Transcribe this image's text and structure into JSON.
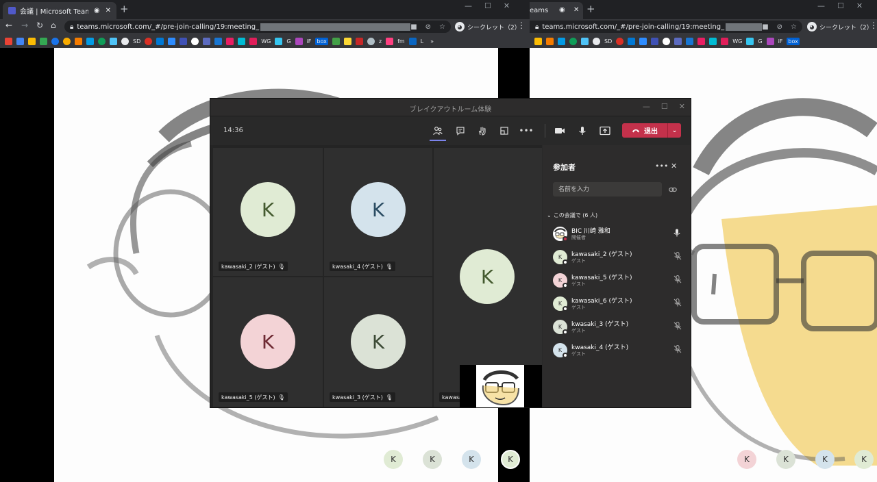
{
  "left_browser": {
    "tab_title": "会議 | Microsoft Teams",
    "url_prefix": "teams.microsoft.com/_#/pre-join-calling/19:meeting_",
    "incognito_label": "シークレット（2）"
  },
  "right_browser": {
    "tab_title": "eams",
    "url_prefix": "teams.microsoft.com/_#/pre-join-calling/19:meeting_",
    "incognito_label": "シークレット（2）"
  },
  "bookmarks": {
    "sd": "SD",
    "wg": "WG",
    "g": "G",
    "if": "iF",
    "box": "box",
    "z": "z",
    "fm": "fm",
    "l": "L",
    "more": "»"
  },
  "teams_window": {
    "title": "ブレイクアウトルーム体験",
    "time": "14:36",
    "leave_label": "退出"
  },
  "tiles": [
    {
      "name": "kawasaki_2 (ゲスト)",
      "initial": "K"
    },
    {
      "name": "kwasaki_4 (ゲスト)",
      "initial": "K"
    },
    {
      "name": "kawasaki_5 (ゲスト)",
      "initial": "K"
    },
    {
      "name": "kwasaki_3 (ゲスト)",
      "initial": "K"
    },
    {
      "name": "kawasak",
      "initial": "K"
    }
  ],
  "participants_panel": {
    "title": "参加者",
    "search_placeholder": "名前を入力",
    "section_label": "この会議で (6 人)",
    "people": [
      {
        "name": "BIC 川崎 雅和",
        "role": "開催者",
        "initial": ""
      },
      {
        "name": "kawasaki_2 (ゲスト)",
        "role": "ゲスト",
        "initial": "K"
      },
      {
        "name": "kawasaki_5 (ゲスト)",
        "role": "ゲスト",
        "initial": "K"
      },
      {
        "name": "kawasaki_6 (ゲスト)",
        "role": "ゲスト",
        "initial": "K"
      },
      {
        "name": "kwasaki_3 (ゲスト)",
        "role": "ゲスト",
        "initial": "K"
      },
      {
        "name": "kwasaki_4 (ゲスト)",
        "role": "ゲスト",
        "initial": "K"
      }
    ]
  },
  "left_dock": [
    "K",
    "K",
    "K",
    "K"
  ],
  "right_dock": [
    "K",
    "K",
    "K",
    "K"
  ],
  "colors": {
    "leave_red": "#c4314b",
    "accent": "#7b83eb",
    "avatar_green": "#e0ebd4",
    "avatar_blue": "#d4e3ec",
    "avatar_pink": "#f3d3d6",
    "avatar_sage": "#dbe2d6"
  }
}
